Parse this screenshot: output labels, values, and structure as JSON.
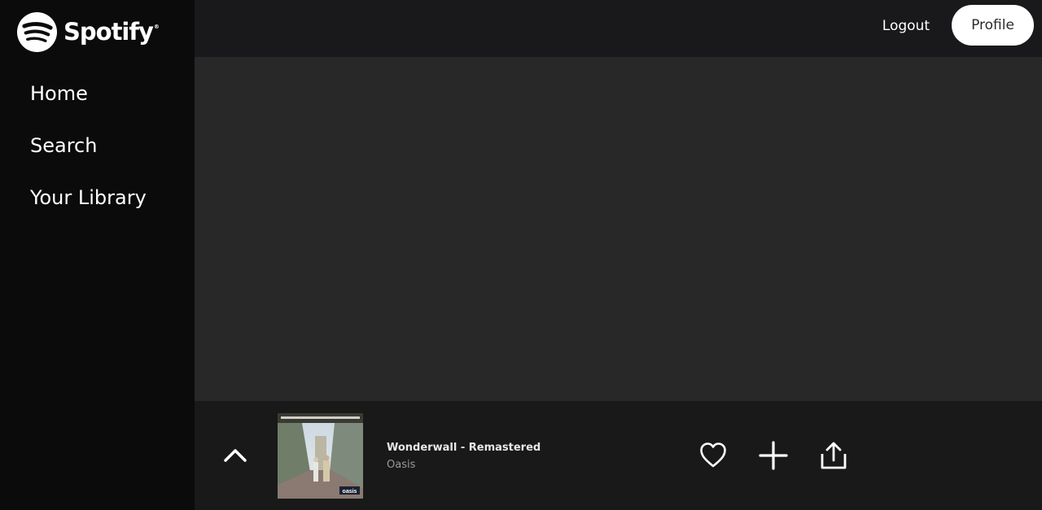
{
  "brand": {
    "name": "Spotify",
    "reg": "®",
    "icon": "spotify-logo-icon",
    "color": "#ffffff"
  },
  "sidebar": {
    "items": [
      {
        "label": "Home"
      },
      {
        "label": "Search"
      },
      {
        "label": "Your Library"
      }
    ]
  },
  "topbar": {
    "logout_label": "Logout",
    "profile_label": "Profile"
  },
  "player": {
    "expand_icon": "chevron-up-icon",
    "track_title": "Wonderwall - Remastered",
    "artist": "Oasis",
    "album_cover_label": "oasis",
    "actions": [
      "heart-icon",
      "plus-icon",
      "share-icon"
    ]
  },
  "colors": {
    "sidebar_bg": "#0b0b0c",
    "topbar_bg": "#19191b",
    "content_bg": "#282828",
    "player_bg": "#191919",
    "artist_text": "#9a9a9a"
  }
}
